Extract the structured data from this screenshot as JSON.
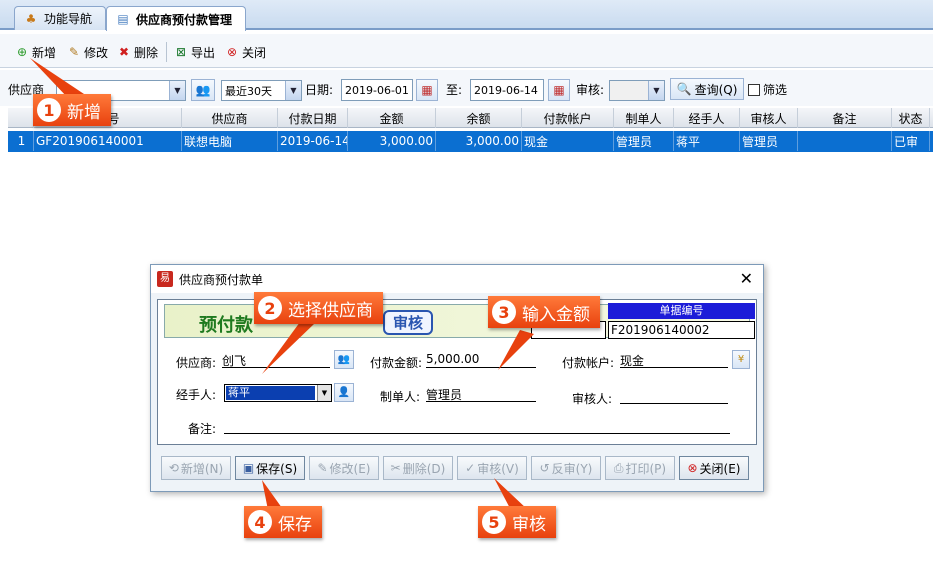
{
  "tabs": [
    {
      "label": "功能导航",
      "icon": "nav-icon"
    },
    {
      "label": "供应商预付款管理",
      "icon": "document-icon"
    }
  ],
  "toolbar": {
    "add": "新增",
    "edit": "修改",
    "delete": "删除",
    "export": "导出",
    "close": "关闭"
  },
  "filter": {
    "supplier_label": "供应商",
    "supplier_value": "",
    "period": "最近30天",
    "date_label": "日期:",
    "date_from": "2019-06-01",
    "to_label": "至:",
    "date_to": "2019-06-14",
    "audit_label": "审核:",
    "audit_value": "",
    "query_label": "查询(Q)",
    "filter_label": "筛选"
  },
  "grid": {
    "columns": [
      "编号",
      "供应商",
      "付款日期",
      "金额",
      "余额",
      "付款帐户",
      "制单人",
      "经手人",
      "审核人",
      "备注",
      "状态"
    ],
    "rows": [
      {
        "index": "1",
        "cells": [
          "GF201906140001",
          "联想电脑",
          "2019-06-14",
          "3,000.00",
          "3,000.00",
          "现金",
          "管理员",
          "蒋平",
          "管理员",
          "",
          "已审"
        ]
      }
    ]
  },
  "dialog": {
    "title": "供应商预付款单",
    "banner_title": "预付款",
    "stamp": "审核",
    "doc_no_label": "单据编号",
    "doc_no": "F201906140002",
    "supplier_label": "供应商:",
    "supplier": "创飞",
    "amount_label": "付款金额:",
    "amount": "5,000.00",
    "account_label": "付款帐户:",
    "account": "现金",
    "handler_label": "经手人:",
    "handler": "蒋平",
    "creator_label": "制单人:",
    "creator": "管理员",
    "auditor_label": "审核人:",
    "auditor": "",
    "note_label": "备注:",
    "note": "",
    "buttons": {
      "add": "新增(N)",
      "save": "保存(S)",
      "edit": "修改(E)",
      "delete": "删除(D)",
      "audit": "审核(V)",
      "unaudit": "反审(Y)",
      "print": "打印(P)",
      "close": "关闭(E)"
    }
  },
  "callouts": [
    {
      "num": "1",
      "text": "新增"
    },
    {
      "num": "2",
      "text": "选择供应商"
    },
    {
      "num": "3",
      "text": "输入金额"
    },
    {
      "num": "4",
      "text": "保存"
    },
    {
      "num": "5",
      "text": "审核"
    }
  ],
  "colors": {
    "selection": "#0b6fd1",
    "callout": "#e8410e",
    "banner_text": "#1f7a1f"
  }
}
